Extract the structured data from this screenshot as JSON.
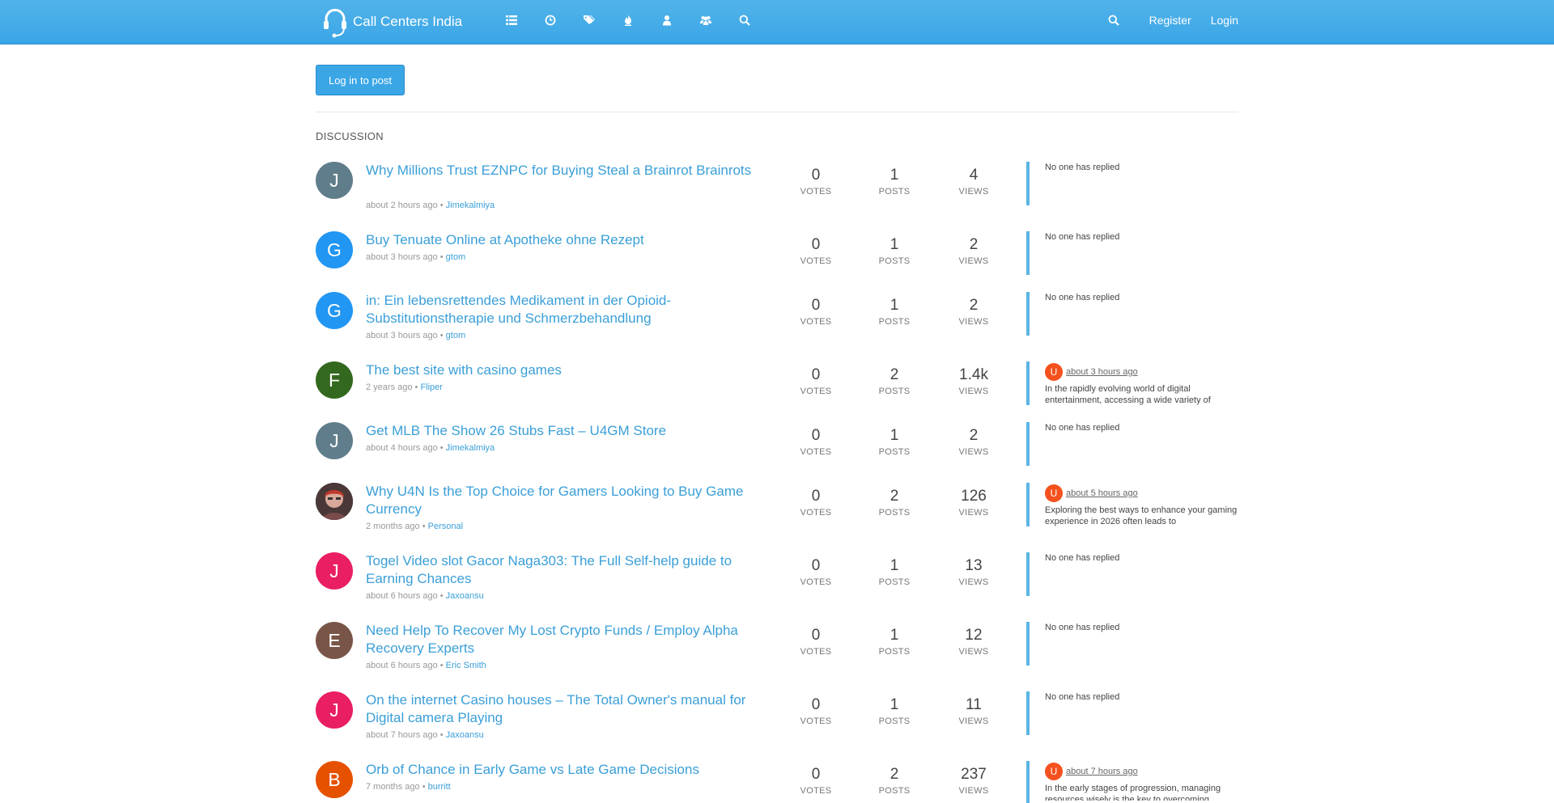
{
  "header": {
    "site_title": "Call Centers India",
    "nav_icons": [
      "list-icon",
      "clock-icon",
      "tags-icon",
      "fire-icon",
      "user-icon",
      "users-icon",
      "search-icon"
    ],
    "register_label": "Register",
    "login_label": "Login",
    "color": "#3aa6e6"
  },
  "actions": {
    "post_label": "Log in to post"
  },
  "section_label": "DISCUSSION",
  "stat_labels": {
    "votes": "VOTES",
    "posts": "POSTS",
    "views": "VIEWS"
  },
  "topics": [
    {
      "title": "Why Millions Trust EZNPC for Buying Steal a Brainrot Brainrots",
      "time": "about 2 hours ago",
      "author": "Jimekalmiya",
      "avatar": "J",
      "avatar_color": "#607d8b",
      "votes": "0",
      "posts": "1",
      "views": "4",
      "teaser": "No one has replied"
    },
    {
      "title": "Buy Tenuate Online at Apotheke ohne Rezept",
      "time": "about 3 hours ago",
      "author": "gtom",
      "avatar": "G",
      "avatar_color": "#2196f3",
      "votes": "0",
      "posts": "1",
      "views": "2",
      "teaser": "No one has replied"
    },
    {
      "title": "in: Ein lebensrettendes Medikament in der Opioid-Substitutionstherapie und Schmerzbehandlung",
      "time": "about 3 hours ago",
      "author": "gtom",
      "avatar": "G",
      "avatar_color": "#2196f3",
      "votes": "0",
      "posts": "1",
      "views": "2",
      "teaser": "No one has replied"
    },
    {
      "title": "The best site with casino games",
      "time": "2 years ago",
      "author": "Fliper",
      "avatar": "F",
      "avatar_color": "#33691e",
      "votes": "0",
      "posts": "2",
      "views": "1.4k",
      "reply_avatar": "U",
      "reply_time": "about 3 hours ago",
      "reply_text": "In the rapidly evolving world of digital entertainment, accessing a wide variety of"
    },
    {
      "title": "Get MLB The Show 26 Stubs Fast – U4GM Store",
      "time": "about 4 hours ago",
      "author": "Jimekalmiya",
      "avatar": "J",
      "avatar_color": "#607d8b",
      "votes": "0",
      "posts": "1",
      "views": "2",
      "teaser": "No one has replied"
    },
    {
      "title": "Why U4N Is the Top Choice for Gamers Looking to Buy Game Currency",
      "time": "2 months ago",
      "author": "Personal",
      "avatar": "",
      "avatar_color": "#5d4a4a",
      "votes": "0",
      "posts": "2",
      "views": "126",
      "reply_avatar": "U",
      "reply_time": "about 5 hours ago",
      "reply_text": "Exploring the best ways to enhance your gaming experience in 2026 often leads to"
    },
    {
      "title": "Togel Video slot Gacor Naga303: The Full Self-help guide to Earning Chances",
      "time": "about 6 hours ago",
      "author": "Jaxoansu",
      "avatar": "J",
      "avatar_color": "#e91e63",
      "votes": "0",
      "posts": "1",
      "views": "13",
      "teaser": "No one has replied"
    },
    {
      "title": "Need Help To Recover My Lost Crypto Funds / Employ Alpha Recovery Experts",
      "time": "about 6 hours ago",
      "author": "Eric Smith",
      "avatar": "E",
      "avatar_color": "#795548",
      "votes": "0",
      "posts": "1",
      "views": "12",
      "teaser": "No one has replied"
    },
    {
      "title": "On the internet Casino houses – The Total Owner's manual for Digital camera Playing",
      "time": "about 7 hours ago",
      "author": "Jaxoansu",
      "avatar": "J",
      "avatar_color": "#e91e63",
      "votes": "0",
      "posts": "1",
      "views": "11",
      "teaser": "No one has replied"
    },
    {
      "title": "Orb of Chance in Early Game vs Late Game Decisions",
      "time": "7 months ago",
      "author": "burritt",
      "avatar": "B",
      "avatar_color": "#e65100",
      "votes": "0",
      "posts": "2",
      "views": "237",
      "reply_avatar": "U",
      "reply_time": "about 7 hours ago",
      "reply_text": "In the early stages of progression, managing resources wisely is the key to overcoming"
    }
  ]
}
